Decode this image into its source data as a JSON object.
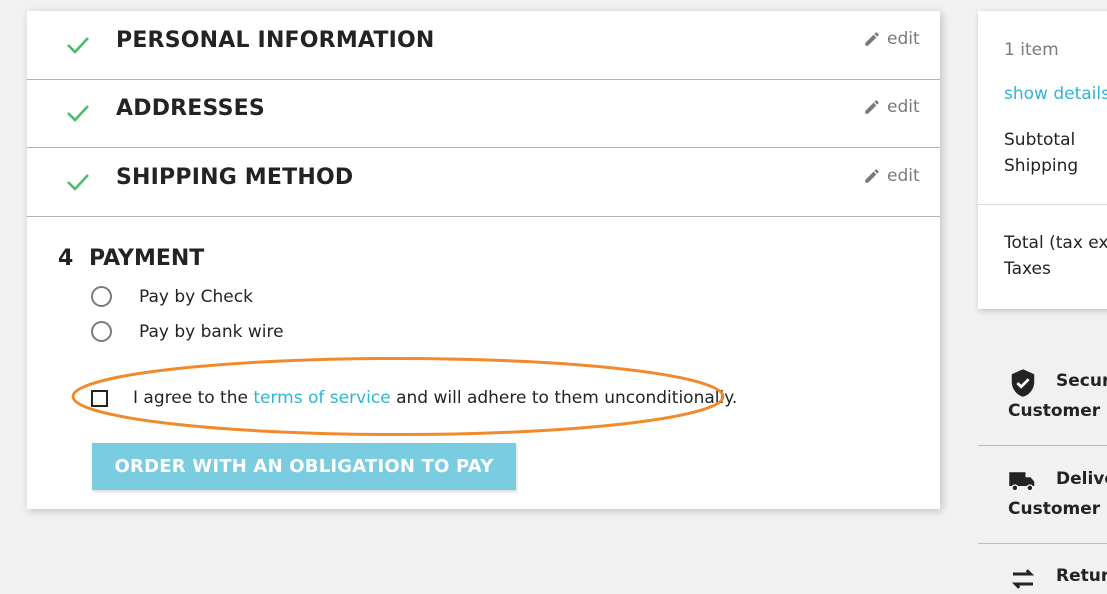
{
  "steps": [
    {
      "title": "PERSONAL INFORMATION",
      "edit": "edit"
    },
    {
      "title": "ADDRESSES",
      "edit": "edit"
    },
    {
      "title": "SHIPPING METHOD",
      "edit": "edit"
    }
  ],
  "payment": {
    "number": "4",
    "title": "PAYMENT",
    "options": [
      "Pay by Check",
      "Pay by bank wire"
    ],
    "terms": {
      "prefix": "I agree to the ",
      "link": "terms of service",
      "suffix": " and will adhere to them unconditionally."
    },
    "order_button": "ORDER WITH AN OBLIGATION TO PAY"
  },
  "summary": {
    "items": "1 item",
    "show_details": "show details",
    "subtotal": "Subtotal",
    "shipping": "Shipping",
    "total": "Total (tax exc",
    "taxes": "Taxes"
  },
  "reassurance": [
    {
      "line1": "Secur",
      "line2": "Customer r",
      "icon": "shield-check-icon"
    },
    {
      "line1": "Delive",
      "line2": "Customer r",
      "icon": "truck-icon"
    },
    {
      "line1": "Retur",
      "line2": "",
      "icon": "arrows-icon"
    }
  ],
  "colors": {
    "check": "#4cbb6c",
    "link": "#2fb5d2",
    "button": "#7acce1",
    "highlight": "#f08a2c"
  }
}
